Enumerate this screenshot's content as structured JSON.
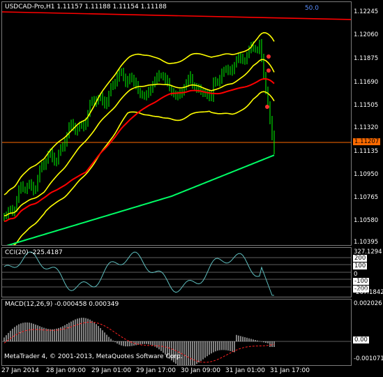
{
  "main": {
    "title": "USDCAD-Pro,H1  1.11157 1.11188 1.11154 1.11188",
    "corner_value": "50.0",
    "price_labels": [
      "1.12245",
      "1.12060",
      "1.11875",
      "1.11690",
      "1.11505",
      "1.11320",
      "1.11135",
      "1.10950",
      "1.10765",
      "1.10580",
      "1.10395"
    ],
    "current_price": "1.11207",
    "colors": {
      "up_candle": "#00ff00",
      "bands": "#ffff00",
      "ma_red": "#ff0000",
      "ma_green": "#00ff66",
      "current_price_bg": "#ff6a00"
    }
  },
  "cci": {
    "title": "CCI(20) -225.4187",
    "scale_labels": [
      "327.1294",
      "200",
      "100",
      "0",
      "-100",
      "-200",
      "-267.1842"
    ]
  },
  "macd": {
    "title": "MACD(12,26,9) -0.000458 0.000349",
    "scale_labels": [
      "0.002026",
      "0.00",
      "-0.001071"
    ]
  },
  "footer": "MetaTrader 4, © 2001-2013, MetaQuotes Software Corp.",
  "time_labels": [
    "27 Jan 2014",
    "28 Jan 09:00",
    "29 Jan 01:00",
    "29 Jan 17:00",
    "30 Jan 09:00",
    "31 Jan 01:00",
    "31 Jan 17:00"
  ]
}
